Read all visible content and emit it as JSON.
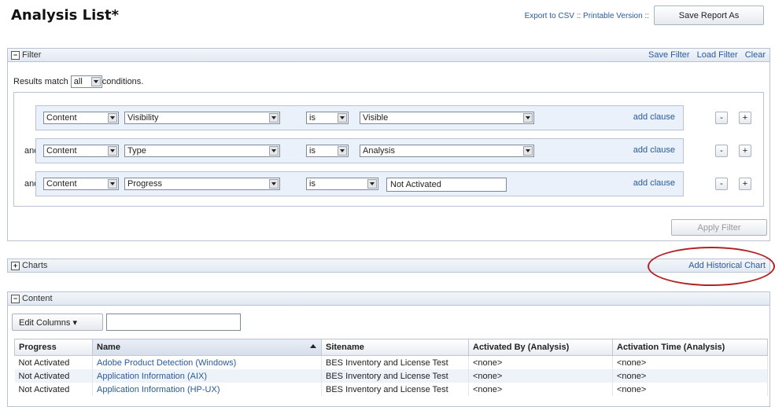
{
  "page": {
    "title": "Analysis List*",
    "export_csv": "Export to CSV",
    "sep1": " :: ",
    "printable": "Printable Version",
    "sep2": " ::",
    "save_report": "Save Report As"
  },
  "filter": {
    "toggle": "−",
    "label": "Filter",
    "save_filter": "Save Filter",
    "load_filter": "Load Filter",
    "clear": "Clear",
    "match_prefix": "Results match",
    "match_value": "all",
    "match_suffix": "conditions.",
    "clauses": [
      {
        "conj": "",
        "source": "Content",
        "field": "Visibility",
        "op": "is",
        "value": "Visible",
        "value_type": "select",
        "add": "add clause"
      },
      {
        "conj": "and",
        "source": "Content",
        "field": "Type",
        "op": "is",
        "value": "Analysis",
        "value_type": "select",
        "add": "add clause"
      },
      {
        "conj": "and",
        "source": "Content",
        "field": "Progress",
        "op": "is",
        "value": "Not Activated",
        "value_type": "text",
        "add": "add clause"
      }
    ],
    "minus": "-",
    "plus": "+",
    "apply": "Apply Filter"
  },
  "charts": {
    "toggle": "+",
    "label": "Charts",
    "add_historical": "Add Historical Chart"
  },
  "content": {
    "toggle": "−",
    "label": "Content",
    "edit_columns": "Edit Columns ▾",
    "columns": [
      "Progress",
      "Name",
      "Sitename",
      "Activated By (Analysis)",
      "Activation Time (Analysis)"
    ],
    "rows": [
      [
        "Not Activated",
        "Adobe Product Detection (Windows)",
        "BES Inventory and License Test",
        "<none>",
        "<none>"
      ],
      [
        "Not Activated",
        "Application Information (AIX)",
        "BES Inventory and License Test",
        "<none>",
        "<none>"
      ],
      [
        "Not Activated",
        "Application Information (HP-UX)",
        "BES Inventory and License Test",
        "<none>",
        "<none>"
      ]
    ]
  },
  "colors": {
    "accent_link": "#2a5a9a",
    "highlight_circle": "#b22222"
  }
}
